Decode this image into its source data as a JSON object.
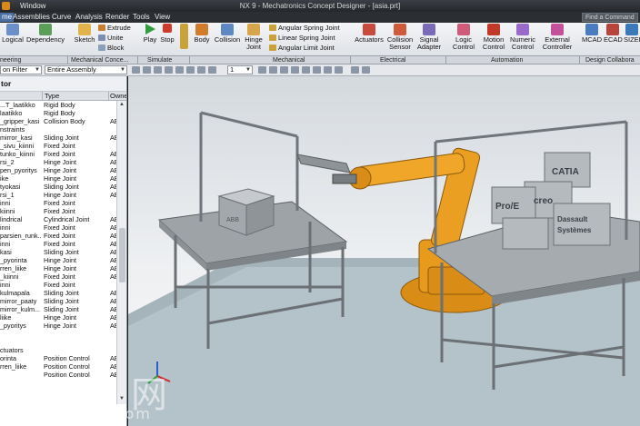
{
  "window": {
    "menu_label": "Window",
    "title": "NX 9 - Mechatronics Concept Designer - [asia.prt]"
  },
  "menubar": {
    "items": [
      "me",
      "Assemblies",
      "Curve",
      "Analysis",
      "Render",
      "Tools",
      "View"
    ],
    "search_placeholder": "Find a Command"
  },
  "ribbon": {
    "logical": "Logical",
    "dependency": "Dependency",
    "sketch": "Sketch",
    "extrude": "Extrude",
    "unite": "Unite",
    "block": "Block",
    "play": "Play",
    "stop": "Stop",
    "body": "Body",
    "collision": "Collision",
    "hinge": "Hinge",
    "hinge2": "Joint",
    "angular_spring": "Angular Spring Joint",
    "linear_spring": "Linear Spring Joint",
    "angular_limit": "Angular Limit Joint",
    "actuators": "Actuators",
    "collision_sensor": "Collision",
    "collision_sensor2": "Sensor",
    "signal_adapter": "Signal",
    "signal_adapter2": "Adapter",
    "logic_control": "Logic",
    "logic_control2": "Control",
    "motion_control": "Motion",
    "motion_control2": "Control",
    "numeric_control": "Numeric",
    "numeric_control2": "Control",
    "external_controller": "External",
    "external_controller2": "Controller",
    "mcad": "MCAD",
    "ecad": "ECAD",
    "sizer": "SIZER"
  },
  "groups": {
    "engineering": "neering",
    "mechanical_concept": "Mechanical Conce...",
    "simulate": "Simulate",
    "mechanical": "Mechanical",
    "electrical": "Electrical",
    "automation": "Automation",
    "design_collab": "Design Collabora"
  },
  "filterbar": {
    "filter_label": "on Filter",
    "assembly_select": "Entire Assembly",
    "page_select": "1"
  },
  "navigator": {
    "title": "tor",
    "col_name": "",
    "col_type": "Type",
    "col_owner": "Owne",
    "rows": [
      {
        "name": "...T_laatikko",
        "type": "Rigid Body",
        "owner": ""
      },
      {
        "name": "laatikko",
        "type": "Rigid Body",
        "owner": ""
      },
      {
        "name": "_gripper_kasi",
        "type": "Collision Body",
        "owner": "AE"
      },
      {
        "name": "nstraints",
        "type": "",
        "owner": ""
      },
      {
        "name": "mirror_kasi",
        "type": "Sliding Joint",
        "owner": "AE"
      },
      {
        "name": "_sivu_kiinni",
        "type": "Fixed Joint",
        "owner": ""
      },
      {
        "name": "tunko_kiinni",
        "type": "Fixed Joint",
        "owner": "AE"
      },
      {
        "name": "rsi_2",
        "type": "Hinge Joint",
        "owner": "AE"
      },
      {
        "name": "pen_pyoritys",
        "type": "Hinge Joint",
        "owner": "AE"
      },
      {
        "name": "ike",
        "type": "Hinge Joint",
        "owner": "AE"
      },
      {
        "name": "tyokasi",
        "type": "Sliding Joint",
        "owner": "AE"
      },
      {
        "name": "rsi_1",
        "type": "Hinge Joint",
        "owner": "AE"
      },
      {
        "name": "inni",
        "type": "Fixed Joint",
        "owner": ""
      },
      {
        "name": "kiinni",
        "type": "Fixed Joint",
        "owner": ""
      },
      {
        "name": "lindrical",
        "type": "Cylindrical Joint",
        "owner": "AE"
      },
      {
        "name": "inni",
        "type": "Fixed Joint",
        "owner": "AE"
      },
      {
        "name": "parsien_runk...",
        "type": "Fixed Joint",
        "owner": "AE"
      },
      {
        "name": "inni",
        "type": "Fixed Joint",
        "owner": "AE"
      },
      {
        "name": "kasi",
        "type": "Sliding Joint",
        "owner": "AE"
      },
      {
        "name": "_pyorinta",
        "type": "Hinge Joint",
        "owner": "AE"
      },
      {
        "name": "rren_liike",
        "type": "Hinge Joint",
        "owner": "AE"
      },
      {
        "name": "_kiinni",
        "type": "Fixed Joint",
        "owner": "AE"
      },
      {
        "name": "inni",
        "type": "Fixed Joint",
        "owner": ""
      },
      {
        "name": "kulmapala",
        "type": "Sliding Joint",
        "owner": "AE"
      },
      {
        "name": "mirror_paaty",
        "type": "Sliding Joint",
        "owner": "AE"
      },
      {
        "name": "mirror_kulm...",
        "type": "Sliding Joint",
        "owner": "AE"
      },
      {
        "name": "liike",
        "type": "Hinge Joint",
        "owner": "AE"
      },
      {
        "name": "_pyoritys",
        "type": "Hinge Joint",
        "owner": "AE"
      },
      {
        "name": "",
        "type": "",
        "owner": ""
      },
      {
        "name": "",
        "type": "",
        "owner": ""
      },
      {
        "name": "ctuators",
        "type": "",
        "owner": ""
      },
      {
        "name": "orinta",
        "type": "Position Control",
        "owner": "AE"
      },
      {
        "name": "rren_liike",
        "type": "Position Control",
        "owner": "AE"
      },
      {
        "name": "",
        "type": "Position Control",
        "owner": "AE"
      }
    ]
  },
  "scene": {
    "box_labels": [
      "CATIA",
      "creo",
      "Pro/E",
      "Dassault",
      "Systèmes"
    ],
    "small_box_label": "ABB"
  },
  "watermark": {
    "cn": "莫西网",
    "url": "www.3dmox.com"
  },
  "colors": {
    "ribbon_bg": "#e9ebee",
    "menubar_bg": "#2b2e33",
    "robot_orange": "#e89a1c",
    "table_gray": "#a9aeb3",
    "box_gray": "#b5babf"
  }
}
